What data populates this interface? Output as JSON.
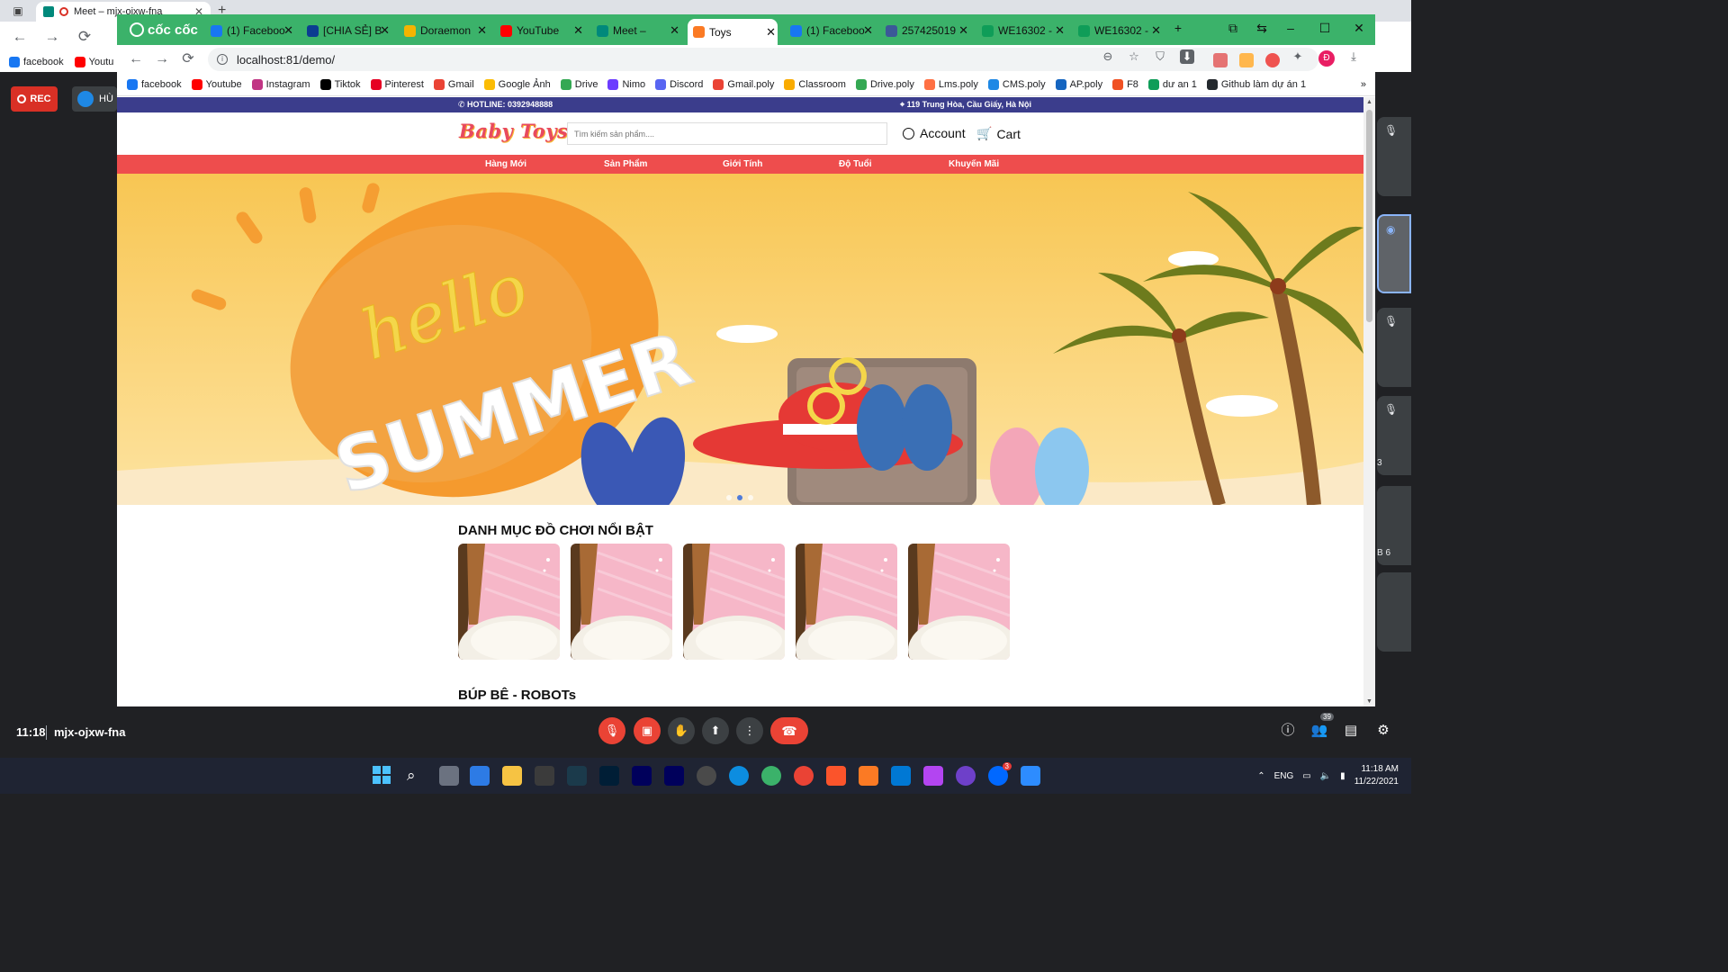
{
  "outer_browser": {
    "tab_title": "Meet – mjx-ojxw-fna",
    "bookmarks": [
      {
        "label": "facebook",
        "icon": "facebook-icon",
        "color": "#1877f2"
      },
      {
        "label": "Youtu",
        "icon": "youtube-icon",
        "color": "#ff0000"
      }
    ]
  },
  "meet": {
    "rec_label": "REC",
    "presenter_initials": "HÙ",
    "time": "11:18",
    "meeting_code": "mjx-ojxw-fna",
    "people_count": "39",
    "side_tile_text": [
      "",
      "3",
      "B 6"
    ]
  },
  "inner_browser": {
    "brand": "cốc cốc",
    "tabs": [
      {
        "label": "(1) Faceboo",
        "icon": "facebook-icon",
        "color": "#1877f2"
      },
      {
        "label": "[CHIA SẺ] B",
        "icon": "document-icon",
        "color": "#0b3d91"
      },
      {
        "label": "Doraemon",
        "icon": "drive-icon",
        "color": "#f4b400"
      },
      {
        "label": "YouTube",
        "icon": "youtube-icon",
        "color": "#ff0000"
      },
      {
        "label": "Meet –",
        "icon": "meet-icon",
        "color": "#00897b"
      },
      {
        "label": "Toys",
        "icon": "xampp-icon",
        "color": "#fb7a24",
        "active": true
      },
      {
        "label": "(1) Faceboo",
        "icon": "facebook-icon",
        "color": "#1877f2"
      },
      {
        "label": "257425019",
        "icon": "facebook-icon",
        "color": "#3b5998"
      },
      {
        "label": "WE16302 -",
        "icon": "classroom-icon",
        "color": "#0f9d58"
      },
      {
        "label": "WE16302 -",
        "icon": "sheets-icon",
        "color": "#0f9d58"
      }
    ],
    "url": "localhost:81/demo/",
    "profile_initial": "Đ",
    "bookmarks": [
      {
        "label": "facebook",
        "icon": "facebook-icon",
        "color": "#1877f2"
      },
      {
        "label": "Youtube",
        "icon": "youtube-icon",
        "color": "#ff0000"
      },
      {
        "label": "Instagram",
        "icon": "instagram-icon",
        "color": "#c13584"
      },
      {
        "label": "Tiktok",
        "icon": "tiktok-icon",
        "color": "#000000"
      },
      {
        "label": "Pinterest",
        "icon": "pinterest-icon",
        "color": "#e60023"
      },
      {
        "label": "Gmail",
        "icon": "gmail-icon",
        "color": "#ea4335"
      },
      {
        "label": "Google Ảnh",
        "icon": "photos-icon",
        "color": "#fbbc05"
      },
      {
        "label": "Drive",
        "icon": "drive-icon",
        "color": "#34a853"
      },
      {
        "label": "Nimo",
        "icon": "nimo-icon",
        "color": "#6c3cff"
      },
      {
        "label": "Discord",
        "icon": "discord-icon",
        "color": "#5865f2"
      },
      {
        "label": "Gmail.poly",
        "icon": "gmail-icon",
        "color": "#ea4335"
      },
      {
        "label": "Classroom",
        "icon": "classroom-icon",
        "color": "#f9ab00"
      },
      {
        "label": "Drive.poly",
        "icon": "drive-icon",
        "color": "#34a853"
      },
      {
        "label": "Lms.poly",
        "icon": "lms-icon",
        "color": "#ff7043"
      },
      {
        "label": "CMS.poly",
        "icon": "cms-icon",
        "color": "#1e88e5"
      },
      {
        "label": "AP.poly",
        "icon": "ap-icon",
        "color": "#1565c0"
      },
      {
        "label": "F8",
        "icon": "f8-icon",
        "color": "#f05123"
      },
      {
        "label": "dư an 1",
        "icon": "classroom-icon",
        "color": "#0f9d58"
      },
      {
        "label": "Github làm dự án 1",
        "icon": "github-icon",
        "color": "#24292e"
      }
    ]
  },
  "site": {
    "hotline": "HOTLINE: 0392948888",
    "address": "119 Trung Hòa, Cầu Giấy, Hà Nội",
    "logo": "Baby Toys",
    "search_placeholder": "Tìm kiếm sản phẩm....",
    "account_label": "Account",
    "cart_label": "Cart",
    "menu": [
      "Hàng Mới",
      "Sản Phẩm",
      "Giới Tính",
      "Độ Tuổi",
      "Khuyến Mãi"
    ],
    "banner": {
      "line1": "hello",
      "line2": "SUMMER"
    },
    "featured_title": "DANH MỤC ĐỒ CHƠI NỔI BẬT",
    "featured_count": 5,
    "dolls_title": "BÚP BÊ - ROBOTs",
    "colors": {
      "topbar": "#3b3d8c",
      "menu": "#ee4d4d",
      "banner": "#fbd26a",
      "logo": "#e84a5f"
    }
  },
  "taskbar": {
    "language": "ENG",
    "time": "11:18 AM",
    "date": "11/22/2021",
    "zalo_badge": "3"
  }
}
